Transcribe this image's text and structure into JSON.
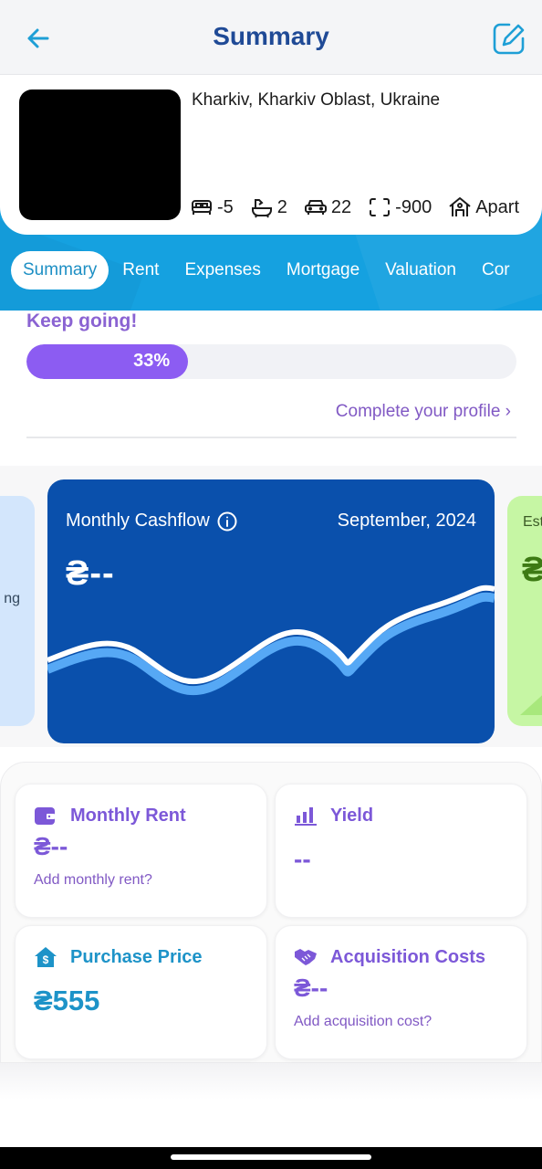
{
  "header": {
    "title": "Summary",
    "back_icon": "arrow-left-icon",
    "edit_icon": "edit-square-icon"
  },
  "property": {
    "address": "Kharkiv, Kharkiv Oblast, Ukraine",
    "stats": [
      {
        "icon": "bed-icon",
        "value": "-5"
      },
      {
        "icon": "bathtub-icon",
        "value": "2"
      },
      {
        "icon": "car-icon",
        "value": "22"
      },
      {
        "icon": "area-icon",
        "value": "-900"
      },
      {
        "icon": "house-icon",
        "value": "Apart"
      }
    ]
  },
  "tabs": [
    {
      "label": "Summary",
      "active": true
    },
    {
      "label": "Rent"
    },
    {
      "label": "Expenses"
    },
    {
      "label": "Mortgage"
    },
    {
      "label": "Valuation"
    },
    {
      "label": "Cor"
    }
  ],
  "progress": {
    "heading": "Keep going!",
    "percent": 33,
    "percent_label": "33%",
    "link": "Complete your profile ›"
  },
  "carousel": {
    "left_partial_text": "ng",
    "main": {
      "label": "Monthly Cashflow",
      "date": "September, 2024",
      "value": "₴--"
    },
    "right_partial": {
      "label": "Est",
      "value": "₴"
    }
  },
  "metrics": {
    "monthly_rent": {
      "title": "Monthly Rent",
      "value": "₴--",
      "link": "Add monthly rent?",
      "icon": "wallet-icon"
    },
    "yield": {
      "title": "Yield",
      "value": "--",
      "icon": "bar-chart-icon"
    },
    "purchase_price": {
      "title": "Purchase Price",
      "value": "₴555",
      "icon": "house-dollar-icon"
    },
    "acquisition_costs": {
      "title": "Acquisition Costs",
      "value": "₴--",
      "link": "Add acquisition cost?",
      "icon": "handshake-icon"
    }
  },
  "colors": {
    "primary_blue": "#15a1e0",
    "dark_blue": "#0a50ac",
    "purple": "#8c5cf2",
    "teal": "#1d93c8"
  }
}
